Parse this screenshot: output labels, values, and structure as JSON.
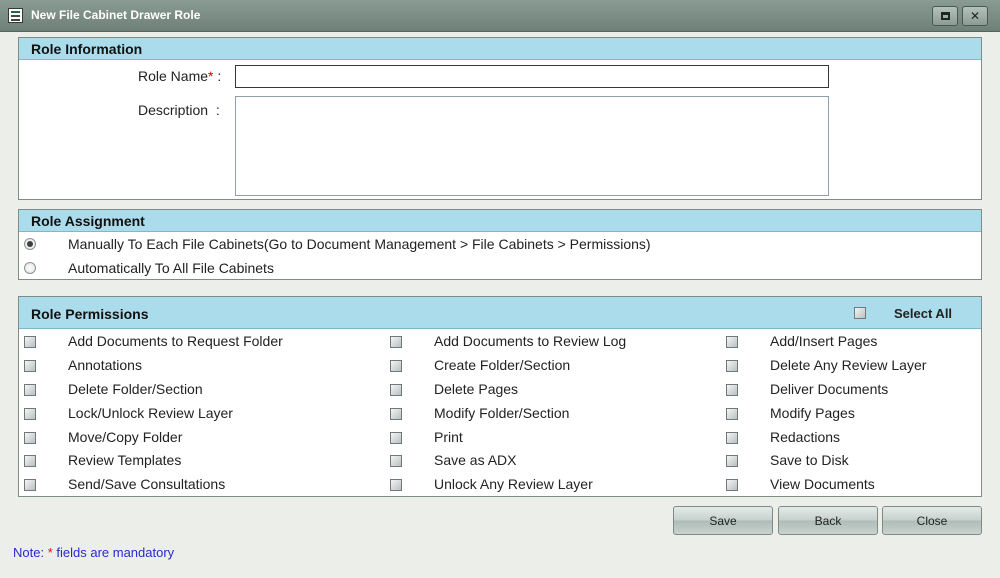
{
  "window": {
    "title": "New File Cabinet Drawer Role",
    "close_glyph": "✕",
    "icons": [
      "form-icon",
      "restore-icon",
      "close-icon"
    ]
  },
  "role_information": {
    "header": "Role Information",
    "role_name_label": "Role Name",
    "required_mark": "*",
    "colon": ":",
    "role_name_value": "",
    "description_label": "Description",
    "description_value": ""
  },
  "role_assignment": {
    "header": "Role Assignment",
    "options": [
      {
        "label": "Manually To Each File Cabinets(Go to Document Management > File Cabinets > Permissions)",
        "selected": true
      },
      {
        "label": "Automatically To All File Cabinets",
        "selected": false
      }
    ]
  },
  "role_permissions": {
    "header": "Role Permissions",
    "select_all_label": "Select All",
    "items": [
      "Add Documents to Request Folder",
      "Add Documents to Review Log",
      "Add/Insert Pages",
      "Annotations",
      "Create Folder/Section",
      "Delete Any Review Layer",
      "Delete Folder/Section",
      "Delete Pages",
      "Deliver Documents",
      "Lock/Unlock Review Layer",
      "Modify Folder/Section",
      "Modify Pages",
      "Move/Copy Folder",
      "Print",
      "Redactions",
      "Review Templates",
      "Save as ADX",
      "Save to Disk",
      "Send/Save Consultations",
      "Unlock Any Review Layer",
      "View Documents"
    ]
  },
  "buttons": {
    "save": "Save",
    "back": "Back",
    "close": "Close"
  },
  "note": {
    "prefix": "Note:",
    "mark": "*",
    "suffix": "fields are mandatory"
  }
}
